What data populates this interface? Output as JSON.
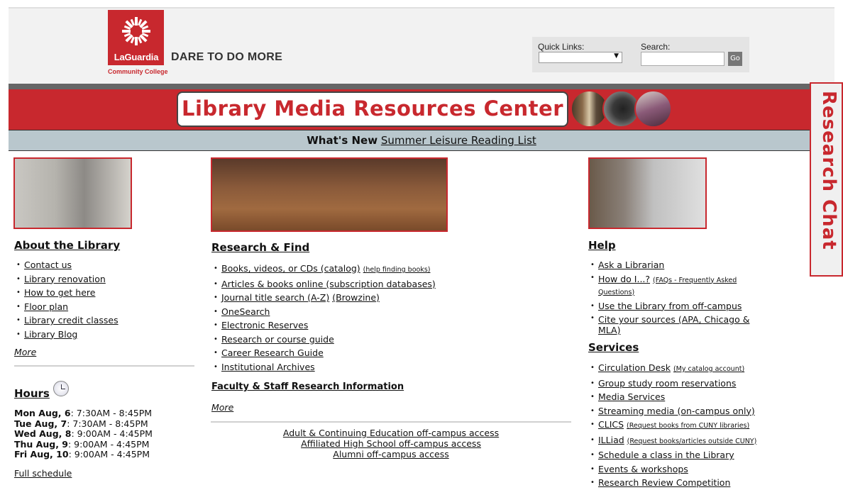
{
  "header": {
    "logo_name": "LaGuardia",
    "logo_sub": "Community College",
    "tagline": "DARE TO DO MORE",
    "quick_links_label": "Quick Links:",
    "search_label": "Search:",
    "go_label": "Go"
  },
  "banner": {
    "title": "Library Media Resources Center"
  },
  "whats_new": {
    "label": "What's New",
    "link": "Summer Leisure Reading List"
  },
  "research_chat": "Research Chat",
  "about": {
    "title": "About the Library",
    "items": [
      "Contact us",
      "Library renovation",
      "How to get here",
      "Floor plan",
      "Library credit classes",
      "Library Blog"
    ],
    "more": "More"
  },
  "hours": {
    "title": "Hours",
    "rows": [
      {
        "day": "Mon Aug, 6",
        "time": ": 7:30AM - 8:45PM"
      },
      {
        "day": "Tue Aug, 7",
        "time": ": 7:30AM - 8:45PM"
      },
      {
        "day": "Wed Aug, 8",
        "time": ": 9:00AM - 4:45PM"
      },
      {
        "day": "Thu Aug, 9",
        "time": ": 9:00AM - 4:45PM"
      },
      {
        "day": "Fri Aug, 10",
        "time": ": 9:00AM - 4:45PM"
      }
    ],
    "full_schedule": "Full schedule"
  },
  "research": {
    "title": "Research & Find",
    "items": [
      {
        "label": "Books, videos, or CDs (catalog)",
        "note": "(help finding books)"
      },
      {
        "label": "Articles & books online (subscription databases)"
      },
      {
        "label": "Journal title search (A-Z)",
        "extra": "(Browzine)"
      },
      {
        "label": "OneSearch"
      },
      {
        "label": "Electronic Reserves"
      },
      {
        "label": "Research or course guide"
      },
      {
        "label": "Career Research Guide"
      },
      {
        "label": "Institutional Archives"
      }
    ],
    "faculty_title": "Faculty & Staff Research Information",
    "more": "More",
    "access_links": [
      "Adult & Continuing Education off-campus access",
      "Affiliated High School off-campus access",
      "Alumni off-campus access"
    ]
  },
  "help": {
    "title": "Help",
    "items": [
      {
        "label": "Ask a Librarian"
      },
      {
        "label": "How do I...?",
        "note": "(FAQs - Frequently Asked Questions)"
      },
      {
        "label": "Use the Library from off-campus"
      },
      {
        "label": "Cite your sources (APA, Chicago & MLA)"
      }
    ]
  },
  "services": {
    "title": "Services",
    "items": [
      {
        "label": "Circulation Desk",
        "note": "(My catalog account)"
      },
      {
        "label": "Group study room reservations"
      },
      {
        "label": "Media Services"
      },
      {
        "label": "Streaming media (on-campus only)"
      },
      {
        "label": "CLICS",
        "note": "(Request books from CUNY libraries)"
      },
      {
        "label": "ILLiad",
        "note": "(Request books/articles outside CUNY)"
      },
      {
        "label": "Schedule a class in the Library"
      },
      {
        "label": "Events & workshops"
      },
      {
        "label": "Research Review Competition"
      }
    ]
  },
  "colors": {
    "brand_red": "#c8282e",
    "whats_new_bg": "#b9c7cd"
  }
}
